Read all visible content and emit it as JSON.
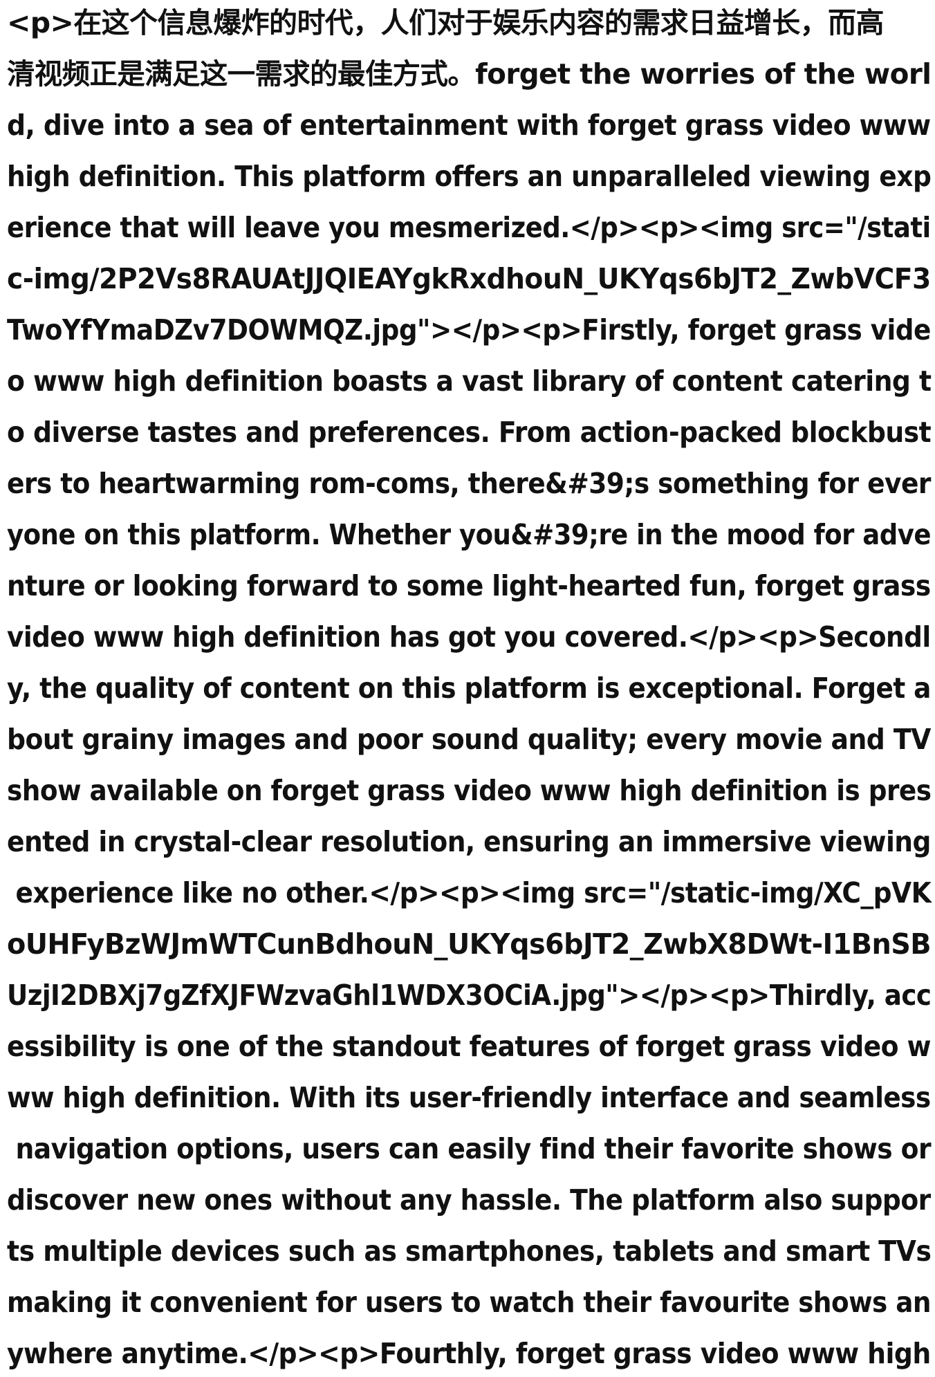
{
  "document": {
    "lines": [
      "<p>在这个信息爆炸的时代，人们对于娱乐内容的需求日益增长，而高",
      "清视频正是满足这一需求的最佳方式。forget the worries of the worl",
      "d, dive into a sea of entertainment with forget grass video www",
      "high definition. This platform offers an unparalleled viewing exp",
      "erience that will leave you mesmerized.</p><p><img src=\"/stati",
      "c-img/2P2Vs8RAUAtJJQIEAYgkRxdhouN_UKYqs6bJT2_ZwbVCF3",
      "TwoYfYmaDZv7DOWMQZ.jpg\"></p><p>Firstly, forget grass vide",
      "o www high definition boasts a vast library of content catering t",
      "o diverse tastes and preferences. From action-packed blockbust",
      "ers to heartwarming rom-coms, there&#39;s something for ever",
      "yone on this platform. Whether you&#39;re in the mood for adve",
      "nture or looking forward to some light-hearted fun, forget grass",
      "video www high definition has got you covered.</p><p>Secondl",
      "y, the quality of content on this platform is exceptional. Forget a",
      "bout grainy images and poor sound quality; every movie and TV",
      "show available on forget grass video www high definition is pres",
      "ented in crystal-clear resolution, ensuring an immersive viewing",
      " experience like no other.</p><p><img src=\"/static-img/XC_pVK",
      "oUHFyBzWJmWTCunBdhouN_UKYqs6bJT2_ZwbX8DWt-I1BnSB",
      "UzjI2DBXj7gZfXJFWzvaGhl1WDX3OCiA.jpg\"></p><p>Thirdly, acc",
      "essibility is one of the standout features of forget grass video w",
      "ww high definition. With its user-friendly interface and seamless",
      " navigation options, users can easily find their favorite shows or",
      "discover new ones without any hassle. The platform also suppor",
      "ts multiple devices such as smartphones, tablets and smart TVs",
      "making it convenient for users to watch their favourite shows an",
      "ywhere anytime.</p><p>Fourthly, forget grass video www high"
    ]
  }
}
